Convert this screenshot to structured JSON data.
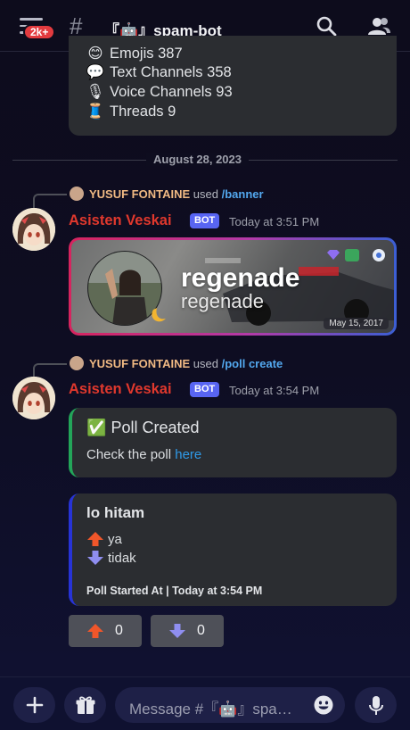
{
  "topbar": {
    "notification_badge": "2k+",
    "channel_hash": "#",
    "channel_name": "『🤖』spam-bot",
    "icons": [
      "hamburger-menu-icon",
      "search-icon",
      "members-icon"
    ]
  },
  "server_stats": {
    "items": [
      {
        "icon": "emoji-icon",
        "emoji": "😊",
        "label": "Emojis",
        "value": "387"
      },
      {
        "icon": "speech-bubble-icon",
        "emoji": "💬",
        "label": "Text Channels",
        "value": "358"
      },
      {
        "icon": "microphone-icon",
        "emoji": "🎙",
        "label": "Voice Channels",
        "value": "93"
      },
      {
        "icon": "thread-spool-icon",
        "emoji": "🧵",
        "label": "Threads",
        "value": "9"
      }
    ]
  },
  "date_divider": "August 28, 2023",
  "messages": [
    {
      "reply": {
        "user": "YUSUF FONTAINE",
        "used": "used",
        "command": "/banner"
      },
      "author": "Asisten Veskai",
      "badge": "BOT",
      "time": "Today at 3:51 PM",
      "banner": {
        "display_name": "regenade",
        "username": "regenade",
        "date": "May 15, 2017"
      }
    },
    {
      "reply": {
        "user": "YUSUF FONTAINE",
        "used": "used",
        "command": "/poll create"
      },
      "author": "Asisten Veskai",
      "badge": "BOT",
      "time": "Today at 3:54 PM",
      "poll_created": {
        "check": "✅",
        "title": "Poll Created",
        "text": "Check the poll ",
        "link": "here"
      },
      "poll": {
        "question": "lo hitam",
        "options": [
          {
            "icon": "arrow-up-icon",
            "label": "ya"
          },
          {
            "icon": "arrow-down-icon",
            "label": "tidak"
          }
        ],
        "footer": "Poll Started At | Today at 3:54 PM"
      },
      "votes": [
        {
          "icon": "arrow-up-icon",
          "count": "0"
        },
        {
          "icon": "arrow-down-icon",
          "count": "0"
        }
      ]
    }
  ],
  "composer": {
    "placeholder": "Message #『🤖』spam-bot",
    "icons": [
      "plus-icon",
      "gift-icon",
      "emoji-smile-icon",
      "microphone-icon"
    ]
  },
  "colors": {
    "accent_blurple": "#5865f2",
    "author_red": "#e0382d",
    "reply_user": "#f0b983",
    "link": "#2f9ae8",
    "success_green": "#23a559",
    "poll_border": "#2733d6"
  }
}
